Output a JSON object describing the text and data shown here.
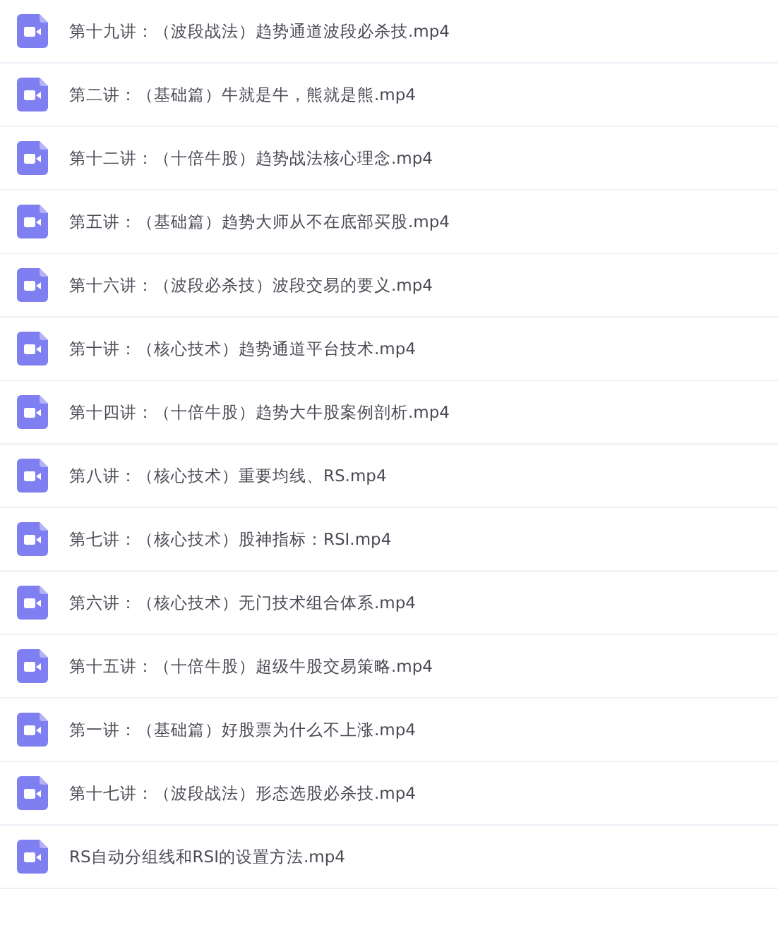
{
  "files": [
    {
      "name": "第十九讲：（波段战法）趋势通道波段必杀技.mp4"
    },
    {
      "name": "第二讲：（基础篇）牛就是牛，熊就是熊.mp4"
    },
    {
      "name": "第十二讲：（十倍牛股）趋势战法核心理念.mp4"
    },
    {
      "name": "第五讲：（基础篇）趋势大师从不在底部买股.mp4"
    },
    {
      "name": "第十六讲：（波段必杀技）波段交易的要义.mp4"
    },
    {
      "name": "第十讲：（核心技术）趋势通道平台技术.mp4"
    },
    {
      "name": "第十四讲：（十倍牛股）趋势大牛股案例剖析.mp4"
    },
    {
      "name": "第八讲：（核心技术）重要均线、RS.mp4"
    },
    {
      "name": "第七讲：（核心技术）股神指标：RSI.mp4"
    },
    {
      "name": "第六讲：（核心技术）无门技术组合体系.mp4"
    },
    {
      "name": "第十五讲：（十倍牛股）超级牛股交易策略.mp4"
    },
    {
      "name": "第一讲：（基础篇）好股票为什么不上涨.mp4"
    },
    {
      "name": "第十七讲：（波段战法）形态选股必杀技.mp4"
    },
    {
      "name": "RS自动分组线和RSI的设置方法.mp4"
    }
  ]
}
